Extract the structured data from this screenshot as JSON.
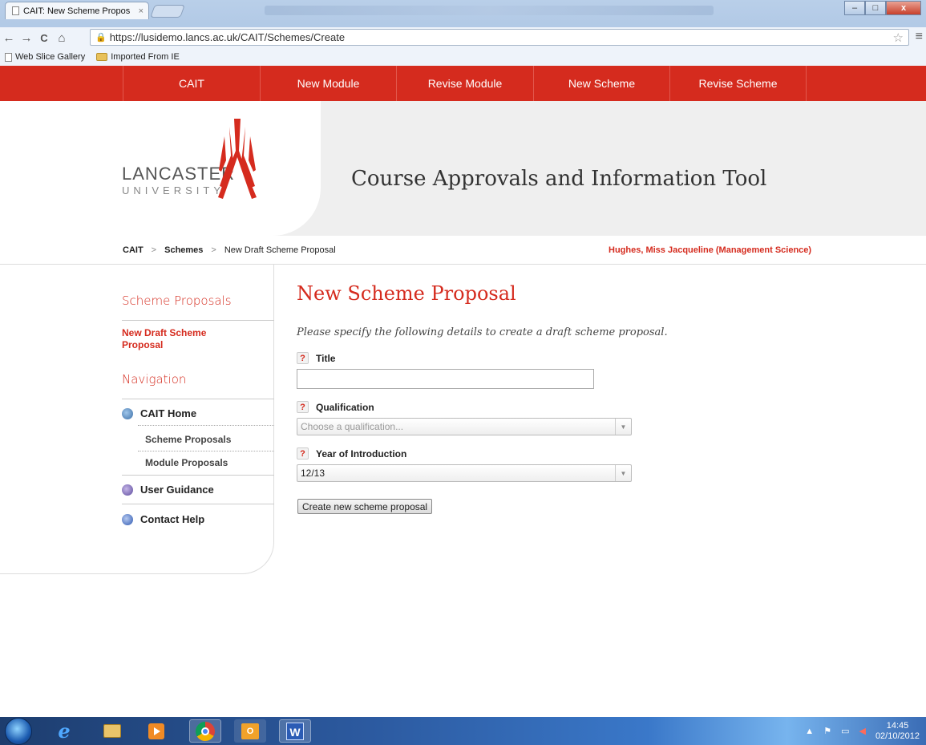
{
  "browser": {
    "tab_title": "CAIT: New Scheme Propos",
    "tab_close": "×",
    "url": "https://lusidemo.lancs.ac.uk/CAIT/Schemes/Create",
    "nav": {
      "back": "←",
      "forward": "→",
      "reload": "C",
      "home": "⌂"
    },
    "window_buttons": {
      "minimize": "–",
      "maximize": "□",
      "close": "x"
    },
    "bookmarks": [
      "Web Slice Gallery",
      "Imported From IE"
    ]
  },
  "topnav": {
    "items": [
      "CAIT",
      "New Module",
      "Revise Module",
      "New Scheme",
      "Revise Scheme"
    ]
  },
  "banner": {
    "logo_line1": "LANCASTER",
    "logo_line2": "UNIVERSITY",
    "title": "Course Approvals and Information Tool"
  },
  "breadcrumb": {
    "items": [
      "CAIT",
      "Schemes",
      "New Draft Scheme Proposal"
    ],
    "separator": ">",
    "user": "Hughes, Miss Jacqueline (Management Science)"
  },
  "sidebar": {
    "section1_title": "Scheme Proposals",
    "section1_link": "New Draft Scheme Proposal",
    "section2_title": "Navigation",
    "nav": [
      {
        "label": "CAIT Home",
        "icon": "home-icon"
      },
      {
        "label": "User Guidance",
        "icon": "info-icon"
      },
      {
        "label": "Contact Help",
        "icon": "help-icon"
      }
    ],
    "sub": [
      "Scheme Proposals",
      "Module Proposals"
    ]
  },
  "main": {
    "title": "New Scheme Proposal",
    "intro": "Please specify the following details to create a draft scheme proposal.",
    "help_mark": "?",
    "fields": {
      "title_label": "Title",
      "title_value": "",
      "qualification_label": "Qualification",
      "qualification_placeholder": "Choose a qualification...",
      "year_label": "Year of Introduction",
      "year_value": "12/13"
    },
    "submit_label": "Create new scheme proposal"
  },
  "taskbar": {
    "time": "14:45",
    "date": "02/10/2012"
  },
  "colors": {
    "brand_red": "#d52b1e",
    "banner_grey": "#efefef"
  }
}
